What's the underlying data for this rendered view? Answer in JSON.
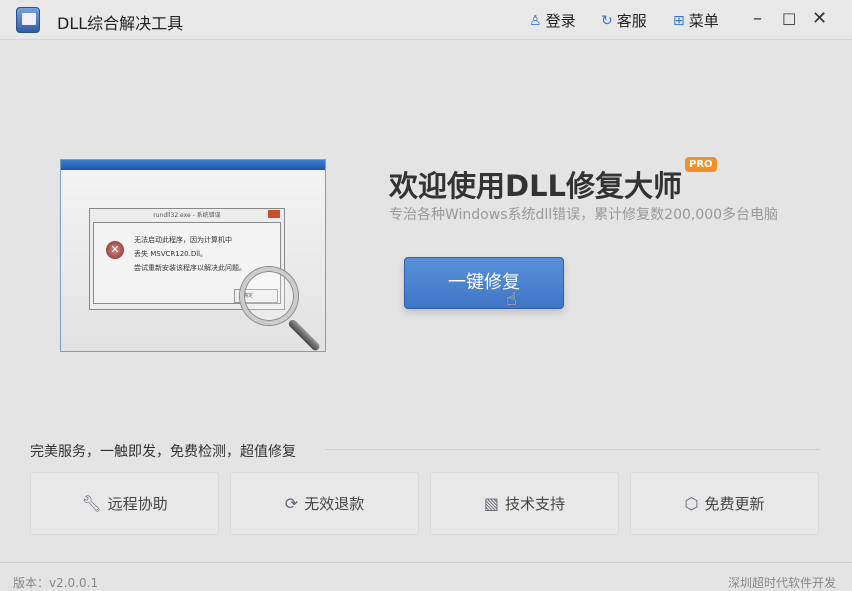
{
  "app": {
    "title": "DLL综合解决工具"
  },
  "titlebar": {
    "login": "登录",
    "service": "客服",
    "menu": "菜单",
    "minimize": "–",
    "maximize": "□",
    "close": "✕"
  },
  "illustration": {
    "dialog_title": "rundll32.exe - 系统错误",
    "message": [
      "无法启动此程序，因为计算机中",
      "丢失 MSVCR120.Dll。",
      "尝试重新安装该程序以解决此问题。"
    ],
    "ok_label": "确定"
  },
  "hero": {
    "headline": "欢迎使用DLL修复大师",
    "badge": "PRO",
    "subtitle": "专治各种Windows系统dll错误，累计修复数200,000多台电脑",
    "fix_button": "一键修复"
  },
  "services": {
    "slogan": "完美服务，一触即发，免费检测，超值修复",
    "items": [
      {
        "label": "远程协助",
        "icon": "wrench-icon"
      },
      {
        "label": "无效退款",
        "icon": "refund-icon"
      },
      {
        "label": "技术支持",
        "icon": "monitor-chart-icon"
      },
      {
        "label": "免费更新",
        "icon": "update-hex-icon"
      }
    ]
  },
  "footer": {
    "version": "版本：v2.0.0.1",
    "company": "深圳超时代软件开发"
  },
  "colors": {
    "accent": "#4a82cf",
    "badge": "#f0902a"
  }
}
